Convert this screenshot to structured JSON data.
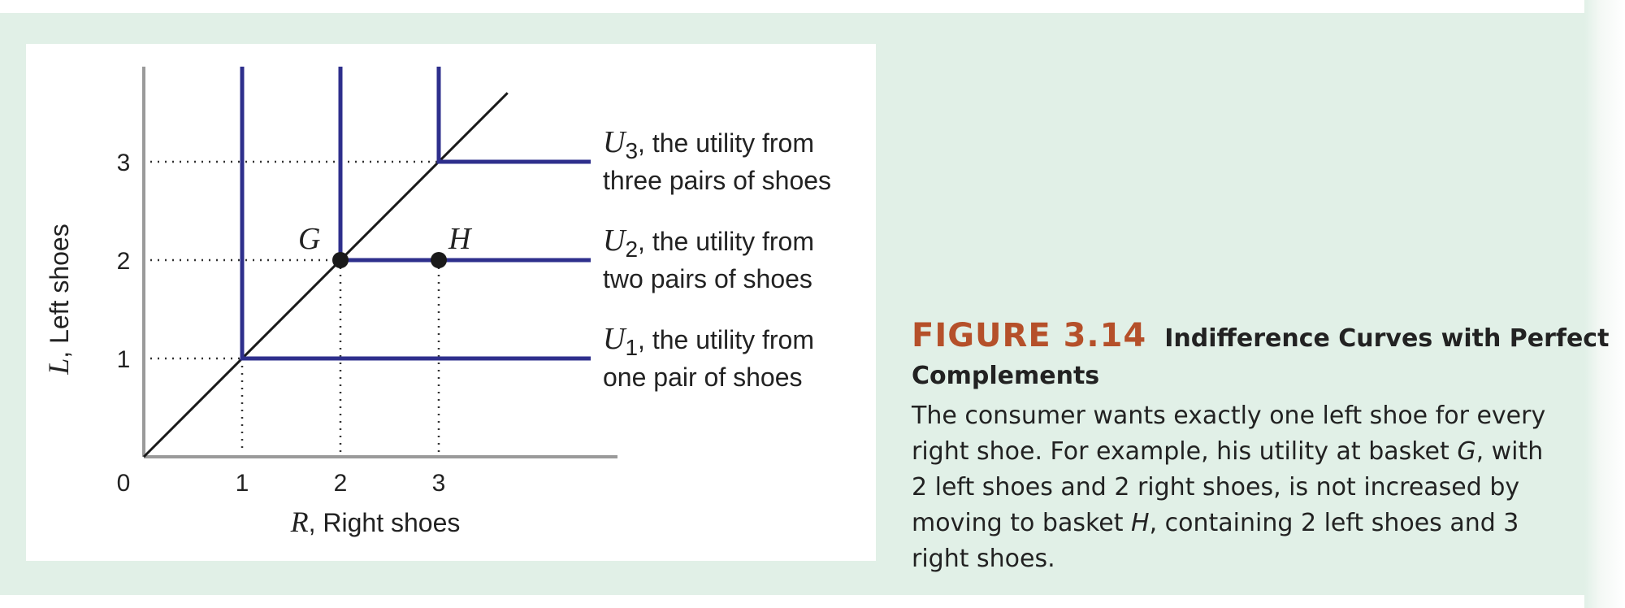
{
  "chart_data": {
    "type": "line",
    "xlabel_var": "R",
    "xlabel_text": ", Right shoes",
    "ylabel_var": "L",
    "ylabel_text": ", Left shoes",
    "origin_label": "0",
    "x_ticks": [
      1,
      2,
      3
    ],
    "y_ticks": [
      1,
      2,
      3
    ],
    "xlim": [
      0,
      4.8
    ],
    "ylim": [
      0,
      4.0
    ],
    "grid": false,
    "colors": {
      "curves": "#2e2f8c",
      "ray": "#1a1a1a",
      "axes": "#9a9a9a",
      "guides": "#333333"
    },
    "series": [
      {
        "name": "U1",
        "sub": "1",
        "label_line1": ", the utility from",
        "label_line2": "one pair of shoes",
        "corner": [
          1,
          1
        ]
      },
      {
        "name": "U2",
        "sub": "2",
        "label_line1": ", the utility from",
        "label_line2": "two pairs of shoes",
        "corner": [
          2,
          2
        ]
      },
      {
        "name": "U3",
        "sub": "3",
        "label_line1": ", the utility from",
        "label_line2": "three pairs of shoes",
        "corner": [
          3,
          3
        ]
      }
    ],
    "points": [
      {
        "label": "G",
        "x": 2,
        "y": 2
      },
      {
        "label": "H",
        "x": 3,
        "y": 2
      }
    ]
  },
  "caption": {
    "figure_number": "FIGURE 3.14",
    "title_line1": "Indifference Curves with Perfect",
    "title_line2": "Complements",
    "body": [
      "The consumer wants exactly one left shoe for every",
      "right shoe. For example, his utility at basket ",
      "G",
      ", with",
      "2 left shoes and 2 right shoes, is not increased by",
      "moving to basket ",
      "H",
      ", containing 2 left shoes and 3",
      "right shoes."
    ]
  }
}
